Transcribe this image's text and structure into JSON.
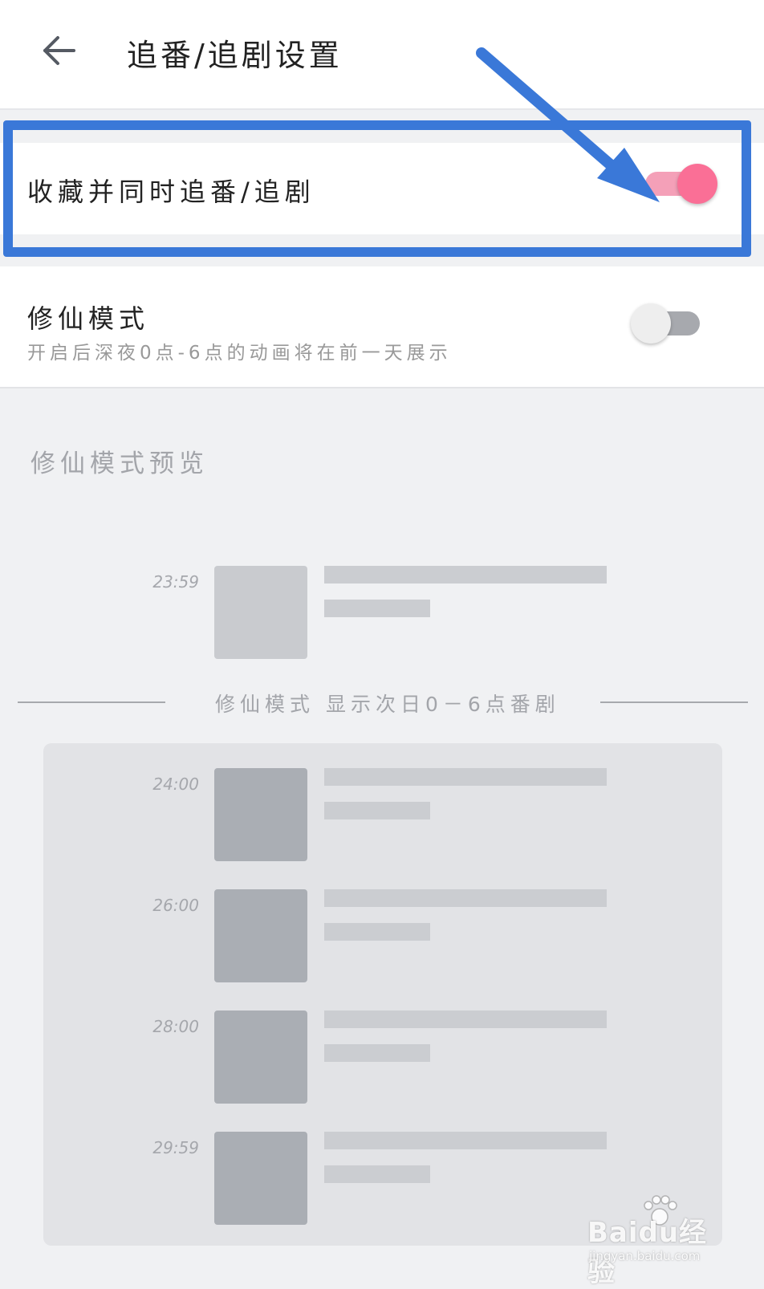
{
  "header": {
    "title": "追番/追剧设置",
    "back_icon": "arrow-left-icon"
  },
  "settings": {
    "follow": {
      "label": "收藏并同时追番/追剧",
      "enabled": true,
      "toggle_color": "#fa6f96"
    },
    "xiuxian": {
      "label": "修仙模式",
      "description": "开启后深夜0点-6点的动画将在前一天展示",
      "enabled": false
    }
  },
  "preview": {
    "title": "修仙模式预览",
    "divider_text": "修仙模式  显示次日0－6点番剧",
    "today_items": [
      {
        "time": "23:59"
      }
    ],
    "next_day_items": [
      {
        "time": "24:00"
      },
      {
        "time": "26:00"
      },
      {
        "time": "28:00"
      },
      {
        "time": "29:59"
      }
    ]
  },
  "annotation": {
    "color": "#3a78d8"
  },
  "watermark": {
    "brand": "Baidu经验",
    "url": "jingyan.baidu.com"
  }
}
